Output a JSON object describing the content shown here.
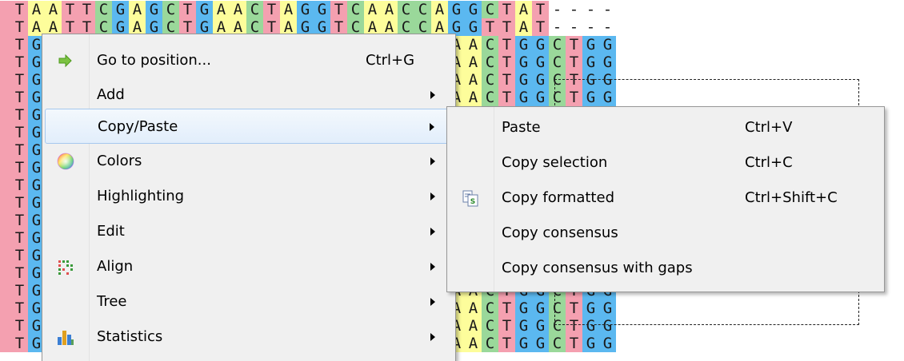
{
  "alignment_rows": [
    "TAATTCGAGCTGAACTAGGTCAACCAGGCTAT----",
    "TAATTCGAGCTGAACTAGGTCAACCAGGTTAT----",
    "TGAGCTGAACTGAGCTGAACTTGGCCAACTGGCTGG",
    "TGAGCTGAACTGAGCTGAATTAGGTCAACTGGCTGG",
    "TGAGCTGAACTGAGCTGAACTAGGTCAACTGGCTGG",
    "TGAGCTGAACTGAGCTGAACTAGGTCAACTGGCTGG",
    "TGAGCTGAACTGAGCTGAACTAGGTCAACTGGCTGG",
    "TGAGCTGAACTGAGCTGAACTAGGTCAACTGGCTGG",
    "TGAGCTGAACTGAGCTGAACTAGGTCAACTGGCTGG",
    "TGAGCTGAACTGAGCTGAACTAGGTCAACTGGCTGG",
    "TGAGCTGAACTGAGCTGAACTAGGTCAACTGGCTGG",
    "TGAGCTGAACTGAGCTGAACTAGGTCAACTGGCTGG",
    "TGAGCTGAACTGAGCTGAACTAGGTCAACTGGCTGG",
    "TGAGCTGAACTGAGCTGAACTAGGTCAACTGGCTGG",
    "TGAGCTGAACTGAGCTGAACTAGGTCAACTGGCTGG",
    "TGAGCTGAACTGAGCTGAACTAGGTCAACTGGCTGG",
    "TGAGCTGAACTGAGCTGAATTAGGACAACTGGCTGG",
    "TGAGCTGAACTGAGCTGAATTAGGACAACTGGCTGG",
    "TGAGCTGAACTGAGCTGAATTAGGACAACTGGCTGG",
    "TGAGCTGAACTGAGCTGAATTAGGACAACTGGCTGG"
  ],
  "nucleotide_colors": {
    "A": "#fdfd9b",
    "C": "#9ad89a",
    "G": "#5bb8f0",
    "T": "#f4a0b0"
  },
  "context_menu": {
    "items": [
      {
        "label": "Go to position...",
        "shortcut": "Ctrl+G",
        "icon": "green-arrow-icon",
        "submenu": false
      },
      {
        "label": "Add",
        "shortcut": "",
        "icon": "",
        "submenu": true
      },
      {
        "label": "Copy/Paste",
        "shortcut": "",
        "icon": "",
        "submenu": true,
        "highlighted": true
      },
      {
        "label": "Colors",
        "shortcut": "",
        "icon": "color-wheel-icon",
        "submenu": true
      },
      {
        "label": "Highlighting",
        "shortcut": "",
        "icon": "",
        "submenu": true
      },
      {
        "label": "Edit",
        "shortcut": "",
        "icon": "",
        "submenu": true
      },
      {
        "label": "Align",
        "shortcut": "",
        "icon": "align-icon",
        "submenu": true
      },
      {
        "label": "Tree",
        "shortcut": "",
        "icon": "",
        "submenu": true
      },
      {
        "label": "Statistics",
        "shortcut": "",
        "icon": "bar-chart-icon",
        "submenu": true
      }
    ]
  },
  "copy_paste_submenu": {
    "items": [
      {
        "label": "Paste",
        "shortcut": "Ctrl+V",
        "icon": ""
      },
      {
        "label": "Copy selection",
        "shortcut": "Ctrl+C",
        "icon": ""
      },
      {
        "label": "Copy formatted",
        "shortcut": "Ctrl+Shift+C",
        "icon": "copy-formatted-icon"
      },
      {
        "label": "Copy consensus",
        "shortcut": "",
        "icon": ""
      },
      {
        "label": "Copy consensus with gaps",
        "shortcut": "",
        "icon": ""
      }
    ]
  }
}
